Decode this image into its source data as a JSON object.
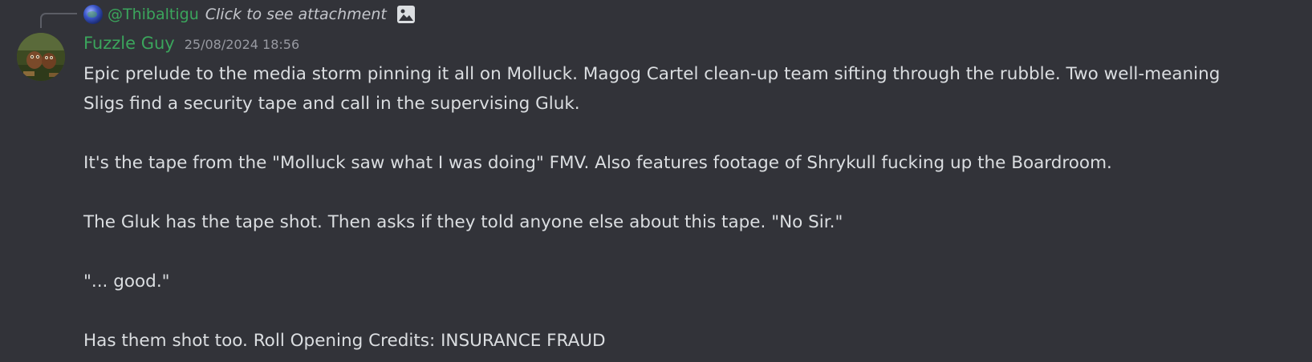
{
  "reply": {
    "author": "@Thibaltigu",
    "preview_text": "Click to see attachment",
    "avatar_icon": "globe-avatar",
    "attachment_icon": "image-icon"
  },
  "message": {
    "author": "Fuzzle Guy",
    "author_color": "#3ba55c",
    "timestamp": "25/08/2024 18:56",
    "avatar_icon": "creature-avatar",
    "lines": [
      "Epic prelude to the media storm pinning it all on Molluck. Magog Cartel clean-up team sifting through the rubble. Two well-meaning",
      "Sligs find a security tape and call in the supervising Gluk.",
      "It's the tape from the \"Molluck saw what I was doing\" FMV. Also features footage of Shrykull fucking up the Boardroom.",
      "The Gluk has the tape shot. Then asks if they told anyone else about this tape. \"No Sir.\"",
      "\"... good.\"",
      "Has them shot too. Roll Opening Credits: INSURANCE FRAUD"
    ]
  },
  "colors": {
    "background": "#323339",
    "text": "#dbdee1",
    "muted": "#989aa2"
  }
}
